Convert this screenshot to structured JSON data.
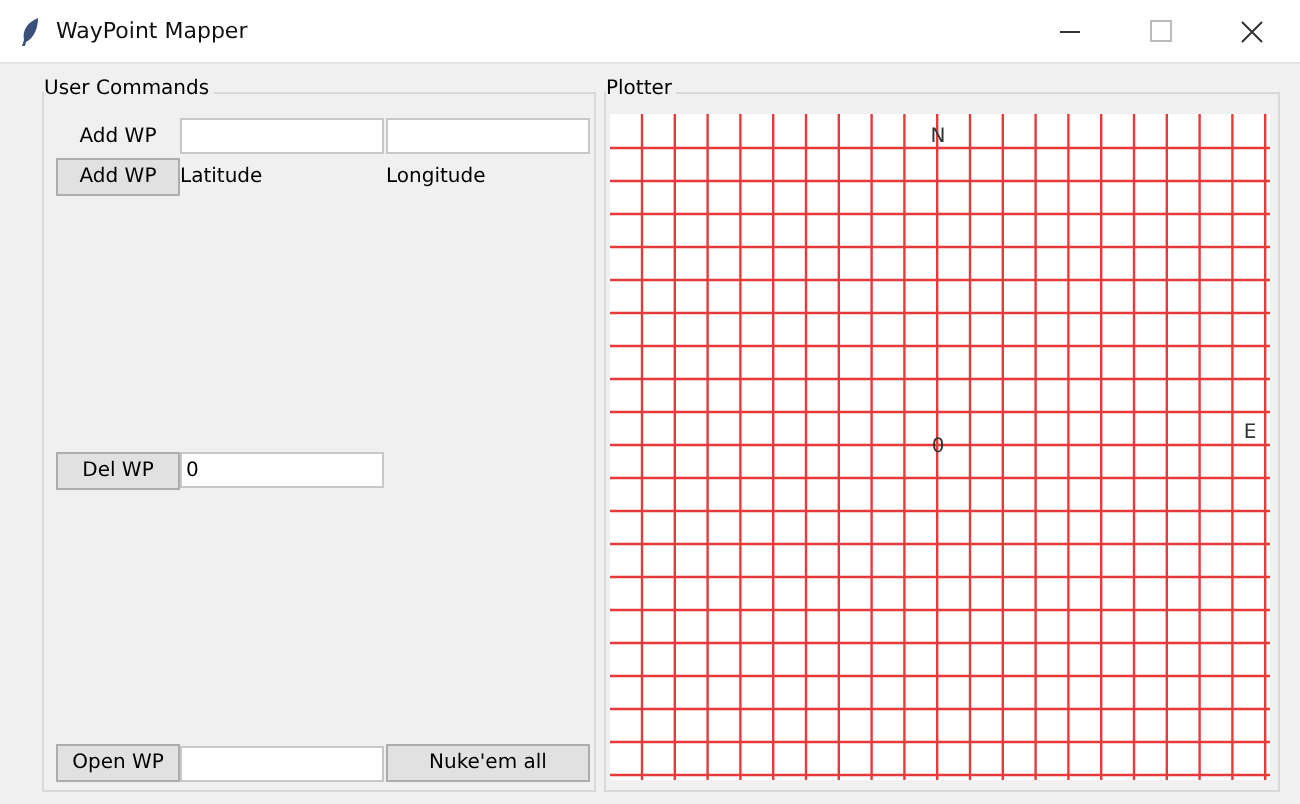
{
  "window": {
    "title": "WayPoint Mapper"
  },
  "user_commands": {
    "title": "User Commands",
    "add_row": {
      "label": "Add WP"
    },
    "add_button": "Add WP",
    "latitude_label": "Latitude",
    "longitude_label": "Longitude",
    "del_button": "Del WP",
    "del_value": "0",
    "open_button": "Open WP",
    "nuke_button": "Nuke'em all"
  },
  "plotter": {
    "title": "Plotter",
    "north_label": "N",
    "origin_label": "0",
    "east_label": "E"
  }
}
